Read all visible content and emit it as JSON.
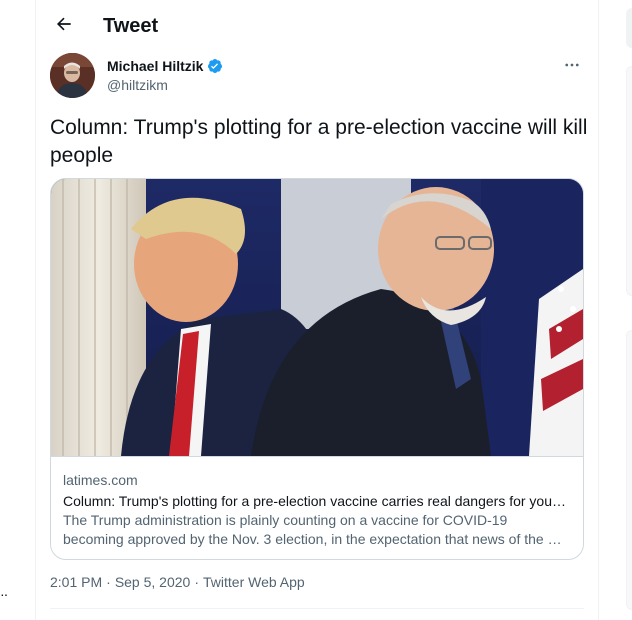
{
  "header": {
    "back_icon": "arrow-left-icon",
    "title": "Tweet"
  },
  "author": {
    "name": "Michael Hiltzik",
    "handle": "@hiltzikm",
    "verified": true,
    "verified_icon": "verified-badge-icon",
    "verified_color": "#1d9bf0",
    "more_icon": "more-horizontal-icon"
  },
  "tweet": {
    "text": "Column: Trump's plotting for a pre-election vaccine will kill people"
  },
  "card": {
    "domain": "latimes.com",
    "title": "Column: Trump's plotting for a pre-election vaccine carries real dangers for you…",
    "description": "The Trump administration is plainly counting on a vaccine for COVID-19 becoming approved by the Nov. 3 election, in the expectation that news of the …"
  },
  "meta": {
    "time": "2:01 PM",
    "sep1": "·",
    "date": "Sep 5, 2020",
    "sep2": "·",
    "source": "Twitter Web App"
  },
  "left_gutter": {
    "more_label": "··"
  },
  "colors": {
    "text_primary": "#0f1419",
    "text_secondary": "#536471",
    "border": "#cfd9de",
    "accent": "#1d9bf0"
  }
}
